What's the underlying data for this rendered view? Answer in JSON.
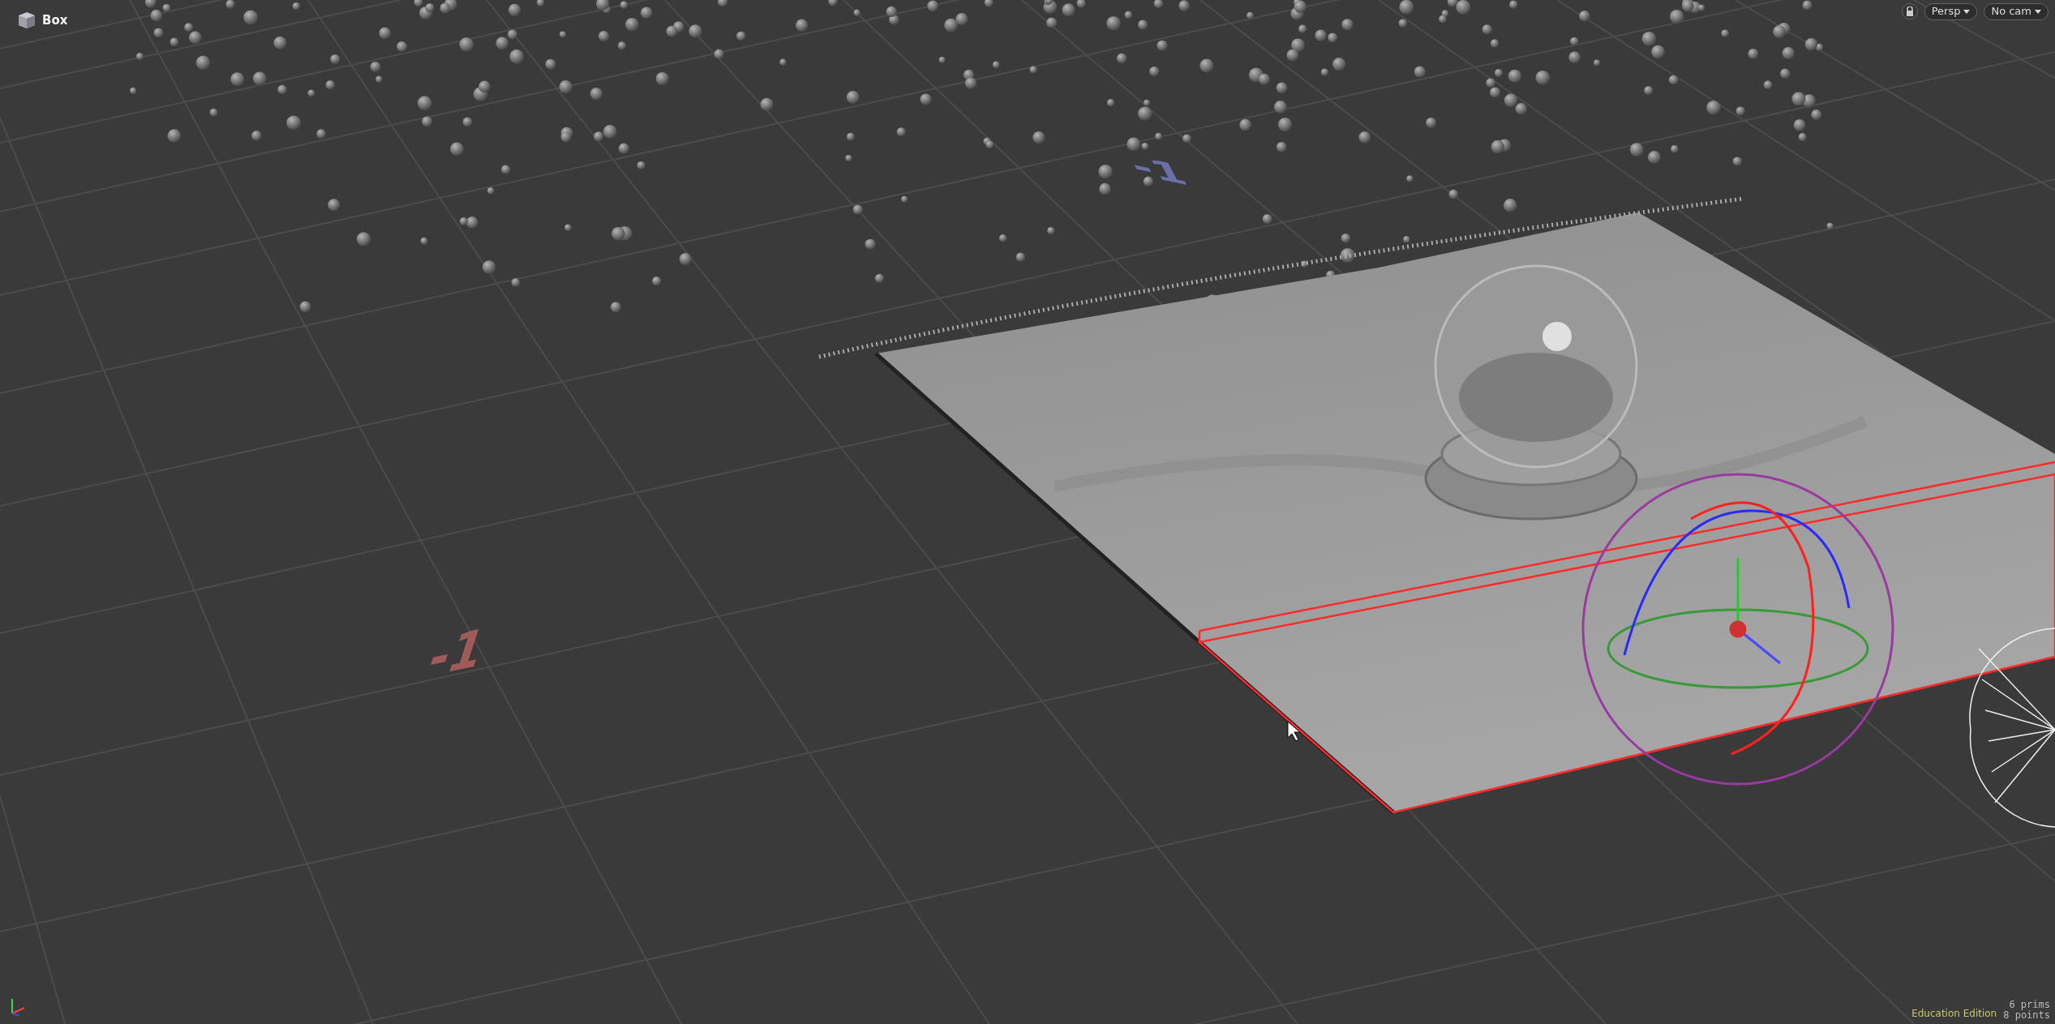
{
  "viewport": {
    "title": "Box",
    "view_buttons": [
      {
        "label": "Persp"
      },
      {
        "label": "No cam"
      }
    ],
    "grid_labels": [
      {
        "text": "-1",
        "color": "#a05a5a"
      },
      {
        "text": "-1",
        "color": "#6a6fa8"
      }
    ],
    "stats": [
      "6 prims",
      "8 points"
    ],
    "edition": "Education Edition"
  }
}
